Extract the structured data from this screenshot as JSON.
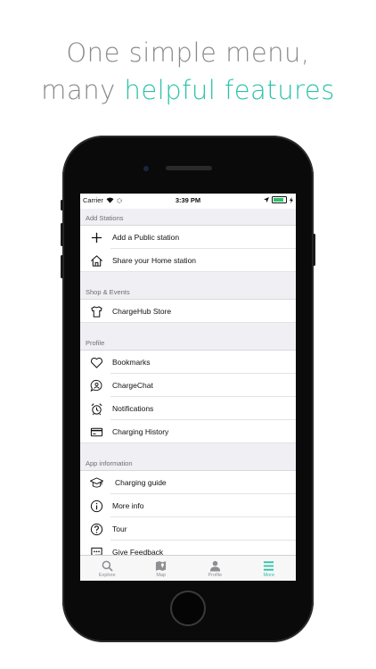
{
  "headline": {
    "line1": "One simple menu,",
    "line2_plain": "many ",
    "line2_accent": "helpful features"
  },
  "colors": {
    "accent": "#2bc2a9",
    "headline": "#8a8a8a",
    "section_bg": "#efeff4"
  },
  "status_bar": {
    "carrier": "Carrier",
    "time": "3:39 PM"
  },
  "sections": [
    {
      "title": "Add Stations",
      "items": [
        {
          "label": "Add a Public station",
          "icon": "plus-icon"
        },
        {
          "label": "Share your Home station",
          "icon": "home-icon"
        }
      ]
    },
    {
      "title": "Shop & Events",
      "items": [
        {
          "label": "ChargeHub Store",
          "icon": "tshirt-icon"
        }
      ]
    },
    {
      "title": "Profile",
      "items": [
        {
          "label": "Bookmarks",
          "icon": "heart-icon"
        },
        {
          "label": "ChargeChat",
          "icon": "chat-user-icon"
        },
        {
          "label": "Notifications",
          "icon": "alarm-clock-icon"
        },
        {
          "label": "Charging History",
          "icon": "credit-card-icon"
        }
      ]
    },
    {
      "title": "App information",
      "items": [
        {
          "label": "Charging guide",
          "icon": "graduation-cap-icon"
        },
        {
          "label": "More info",
          "icon": "info-icon"
        },
        {
          "label": "Tour",
          "icon": "question-icon"
        },
        {
          "label": "Give Feedback",
          "icon": "feedback-icon"
        }
      ]
    }
  ],
  "tabbar": [
    {
      "label": "Explore",
      "icon": "search-icon"
    },
    {
      "label": "Map",
      "icon": "map-icon"
    },
    {
      "label": "Profile",
      "icon": "profile-icon"
    },
    {
      "label": "More",
      "icon": "menu-icon",
      "active": true
    }
  ]
}
